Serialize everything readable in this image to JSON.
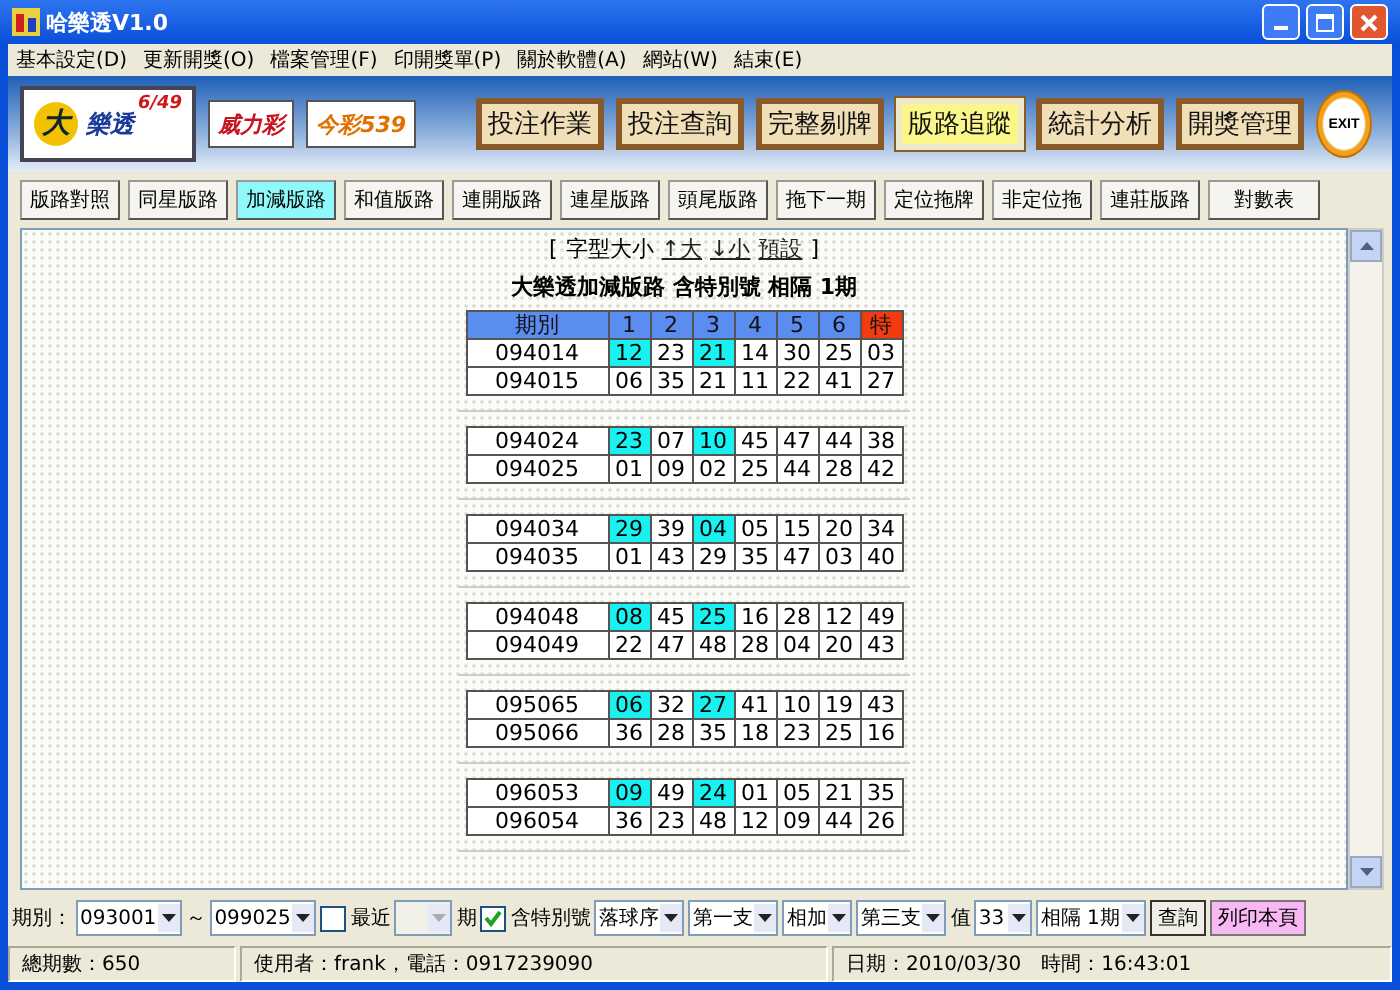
{
  "window": {
    "title": "哈樂透V1.0"
  },
  "menu": [
    "基本設定(D)",
    "更新開獎(O)",
    "檔案管理(F)",
    "印開獎單(P)",
    "關於軟體(A)",
    "網站(W)",
    "結束(E)"
  ],
  "logos": [
    {
      "kind": "big",
      "name": "樂透",
      "mark": "大",
      "badge": "6/49",
      "selected": true
    },
    {
      "kind": "power",
      "name": "威力彩",
      "selected": false
    },
    {
      "kind": "today",
      "name": "今彩539",
      "selected": false
    }
  ],
  "main_buttons": [
    {
      "label": "投注作業",
      "selected": false
    },
    {
      "label": "投注查詢",
      "selected": false
    },
    {
      "label": "完整剔牌",
      "selected": false
    },
    {
      "label": "版路追蹤",
      "selected": true
    },
    {
      "label": "統計分析",
      "selected": false
    },
    {
      "label": "開獎管理",
      "selected": false
    }
  ],
  "exit_button": "EXIT",
  "tabs": [
    {
      "label": "版路對照",
      "selected": false
    },
    {
      "label": "同星版路",
      "selected": false
    },
    {
      "label": "加減版路",
      "selected": true
    },
    {
      "label": "和值版路",
      "selected": false
    },
    {
      "label": "連開版路",
      "selected": false
    },
    {
      "label": "連星版路",
      "selected": false
    },
    {
      "label": "頭尾版路",
      "selected": false
    },
    {
      "label": "拖下一期",
      "selected": false
    },
    {
      "label": "定位拖牌",
      "selected": false
    },
    {
      "label": "非定位拖",
      "selected": false
    },
    {
      "label": "連莊版路",
      "selected": false
    },
    {
      "label": "對數表",
      "selected": false
    }
  ],
  "font_size": {
    "open": "[",
    "label": "字型大小",
    "links": [
      "↑大",
      "↓小",
      "預設"
    ],
    "close": "]"
  },
  "report_title": "大樂透加減版路 含特別號 相隔 1期",
  "table": {
    "columns": [
      {
        "label": "期別",
        "color": "#5b8cf0"
      },
      {
        "label": "1",
        "color": "#5b8cf0"
      },
      {
        "label": "2",
        "color": "#5b8cf0"
      },
      {
        "label": "3",
        "color": "#5b8cf0"
      },
      {
        "label": "4",
        "color": "#5b8cf0"
      },
      {
        "label": "5",
        "color": "#5b8cf0"
      },
      {
        "label": "6",
        "color": "#5b8cf0"
      },
      {
        "label": "特",
        "color": "#f03c10"
      }
    ],
    "groups": [
      {
        "rows": [
          {
            "period": "094014",
            "numbers": [
              {
                "value": "12",
                "highlighted": true
              },
              {
                "value": "23",
                "highlighted": false
              },
              {
                "value": "21",
                "highlighted": true
              },
              {
                "value": "14",
                "highlighted": false
              },
              {
                "value": "30",
                "highlighted": false
              },
              {
                "value": "25",
                "highlighted": false
              },
              {
                "value": "03",
                "highlighted": false
              }
            ]
          },
          {
            "period": "094015",
            "numbers": [
              {
                "value": "06",
                "highlighted": false
              },
              {
                "value": "35",
                "highlighted": false
              },
              {
                "value": "21",
                "highlighted": false
              },
              {
                "value": "11",
                "highlighted": false
              },
              {
                "value": "22",
                "highlighted": false
              },
              {
                "value": "41",
                "highlighted": false
              },
              {
                "value": "27",
                "highlighted": false
              }
            ]
          }
        ]
      },
      {
        "rows": [
          {
            "period": "094024",
            "numbers": [
              {
                "value": "23",
                "highlighted": true
              },
              {
                "value": "07",
                "highlighted": false
              },
              {
                "value": "10",
                "highlighted": true
              },
              {
                "value": "45",
                "highlighted": false
              },
              {
                "value": "47",
                "highlighted": false
              },
              {
                "value": "44",
                "highlighted": false
              },
              {
                "value": "38",
                "highlighted": false
              }
            ]
          },
          {
            "period": "094025",
            "numbers": [
              {
                "value": "01",
                "highlighted": false
              },
              {
                "value": "09",
                "highlighted": false
              },
              {
                "value": "02",
                "highlighted": false
              },
              {
                "value": "25",
                "highlighted": false
              },
              {
                "value": "44",
                "highlighted": false
              },
              {
                "value": "28",
                "highlighted": false
              },
              {
                "value": "42",
                "highlighted": false
              }
            ]
          }
        ]
      },
      {
        "rows": [
          {
            "period": "094034",
            "numbers": [
              {
                "value": "29",
                "highlighted": true
              },
              {
                "value": "39",
                "highlighted": false
              },
              {
                "value": "04",
                "highlighted": true
              },
              {
                "value": "05",
                "highlighted": false
              },
              {
                "value": "15",
                "highlighted": false
              },
              {
                "value": "20",
                "highlighted": false
              },
              {
                "value": "34",
                "highlighted": false
              }
            ]
          },
          {
            "period": "094035",
            "numbers": [
              {
                "value": "01",
                "highlighted": false
              },
              {
                "value": "43",
                "highlighted": false
              },
              {
                "value": "29",
                "highlighted": false
              },
              {
                "value": "35",
                "highlighted": false
              },
              {
                "value": "47",
                "highlighted": false
              },
              {
                "value": "03",
                "highlighted": false
              },
              {
                "value": "40",
                "highlighted": false
              }
            ]
          }
        ]
      },
      {
        "rows": [
          {
            "period": "094048",
            "numbers": [
              {
                "value": "08",
                "highlighted": true
              },
              {
                "value": "45",
                "highlighted": false
              },
              {
                "value": "25",
                "highlighted": true
              },
              {
                "value": "16",
                "highlighted": false
              },
              {
                "value": "28",
                "highlighted": false
              },
              {
                "value": "12",
                "highlighted": false
              },
              {
                "value": "49",
                "highlighted": false
              }
            ]
          },
          {
            "period": "094049",
            "numbers": [
              {
                "value": "22",
                "highlighted": false
              },
              {
                "value": "47",
                "highlighted": false
              },
              {
                "value": "48",
                "highlighted": false
              },
              {
                "value": "28",
                "highlighted": false
              },
              {
                "value": "04",
                "highlighted": false
              },
              {
                "value": "20",
                "highlighted": false
              },
              {
                "value": "43",
                "highlighted": false
              }
            ]
          }
        ]
      },
      {
        "rows": [
          {
            "period": "095065",
            "numbers": [
              {
                "value": "06",
                "highlighted": true
              },
              {
                "value": "32",
                "highlighted": false
              },
              {
                "value": "27",
                "highlighted": true
              },
              {
                "value": "41",
                "highlighted": false
              },
              {
                "value": "10",
                "highlighted": false
              },
              {
                "value": "19",
                "highlighted": false
              },
              {
                "value": "43",
                "highlighted": false
              }
            ]
          },
          {
            "period": "095066",
            "numbers": [
              {
                "value": "36",
                "highlighted": false
              },
              {
                "value": "28",
                "highlighted": false
              },
              {
                "value": "35",
                "highlighted": false
              },
              {
                "value": "18",
                "highlighted": false
              },
              {
                "value": "23",
                "highlighted": false
              },
              {
                "value": "25",
                "highlighted": false
              },
              {
                "value": "16",
                "highlighted": false
              }
            ]
          }
        ]
      },
      {
        "rows": [
          {
            "period": "096053",
            "numbers": [
              {
                "value": "09",
                "highlighted": true
              },
              {
                "value": "49",
                "highlighted": false
              },
              {
                "value": "24",
                "highlighted": true
              },
              {
                "value": "01",
                "highlighted": false
              },
              {
                "value": "05",
                "highlighted": false
              },
              {
                "value": "21",
                "highlighted": false
              },
              {
                "value": "35",
                "highlighted": false
              }
            ]
          },
          {
            "period": "096054",
            "numbers": [
              {
                "value": "36",
                "highlighted": false
              },
              {
                "value": "23",
                "highlighted": false
              },
              {
                "value": "48",
                "highlighted": false
              },
              {
                "value": "12",
                "highlighted": false
              },
              {
                "value": "09",
                "highlighted": false
              },
              {
                "value": "44",
                "highlighted": false
              },
              {
                "value": "26",
                "highlighted": false
              }
            ]
          }
        ]
      }
    ]
  },
  "controls": [
    {
      "kind": "label",
      "text": "期別："
    },
    {
      "kind": "combo",
      "value": "093001",
      "disabled": false
    },
    {
      "kind": "label",
      "text": "～"
    },
    {
      "kind": "combo",
      "value": "099025",
      "disabled": false
    },
    {
      "kind": "check",
      "text": "最近",
      "checked": false
    },
    {
      "kind": "combo",
      "disabled": true
    },
    {
      "kind": "label",
      "text": "期"
    },
    {
      "kind": "check",
      "text": "含特別號",
      "checked": true
    },
    {
      "kind": "combo",
      "value": "落球序",
      "disabled": false
    },
    {
      "kind": "combo",
      "value": "第一支",
      "disabled": false
    },
    {
      "kind": "combo",
      "value": "相加",
      "disabled": false
    },
    {
      "kind": "combo",
      "value": "第三支",
      "disabled": false
    },
    {
      "kind": "label",
      "text": "值"
    },
    {
      "kind": "combo",
      "value": "33",
      "disabled": false
    },
    {
      "kind": "combo",
      "value": "相隔 1期",
      "disabled": false
    },
    {
      "kind": "button",
      "text": "查詢"
    },
    {
      "kind": "print",
      "text": "列印本頁"
    }
  ],
  "status_bar": {
    "total": "總期數：650",
    "user": "使用者：frank，電話：0917239090",
    "date": "日期：2010/03/30",
    "time": "時間：16:43:01"
  }
}
